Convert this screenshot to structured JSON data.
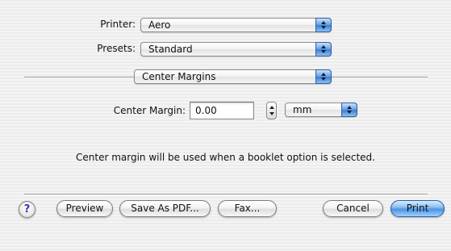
{
  "printer": {
    "label": "Printer:",
    "value": "Aero"
  },
  "presets": {
    "label": "Presets:",
    "value": "Standard"
  },
  "section": {
    "value": "Center Margins"
  },
  "center_margin": {
    "label": "Center Margin:",
    "value": "0.00",
    "unit": "mm"
  },
  "message": "Center margin will be used when a booklet option is selected.",
  "buttons": {
    "help": "?",
    "preview": "Preview",
    "save_pdf": "Save As PDF...",
    "fax": "Fax...",
    "cancel": "Cancel",
    "print": "Print"
  },
  "colors": {
    "accent": "#4c92e2"
  },
  "icons": {
    "help": "help-icon",
    "popup": "popup-arrows-icon",
    "stepper": "stepper-arrows-icon"
  }
}
